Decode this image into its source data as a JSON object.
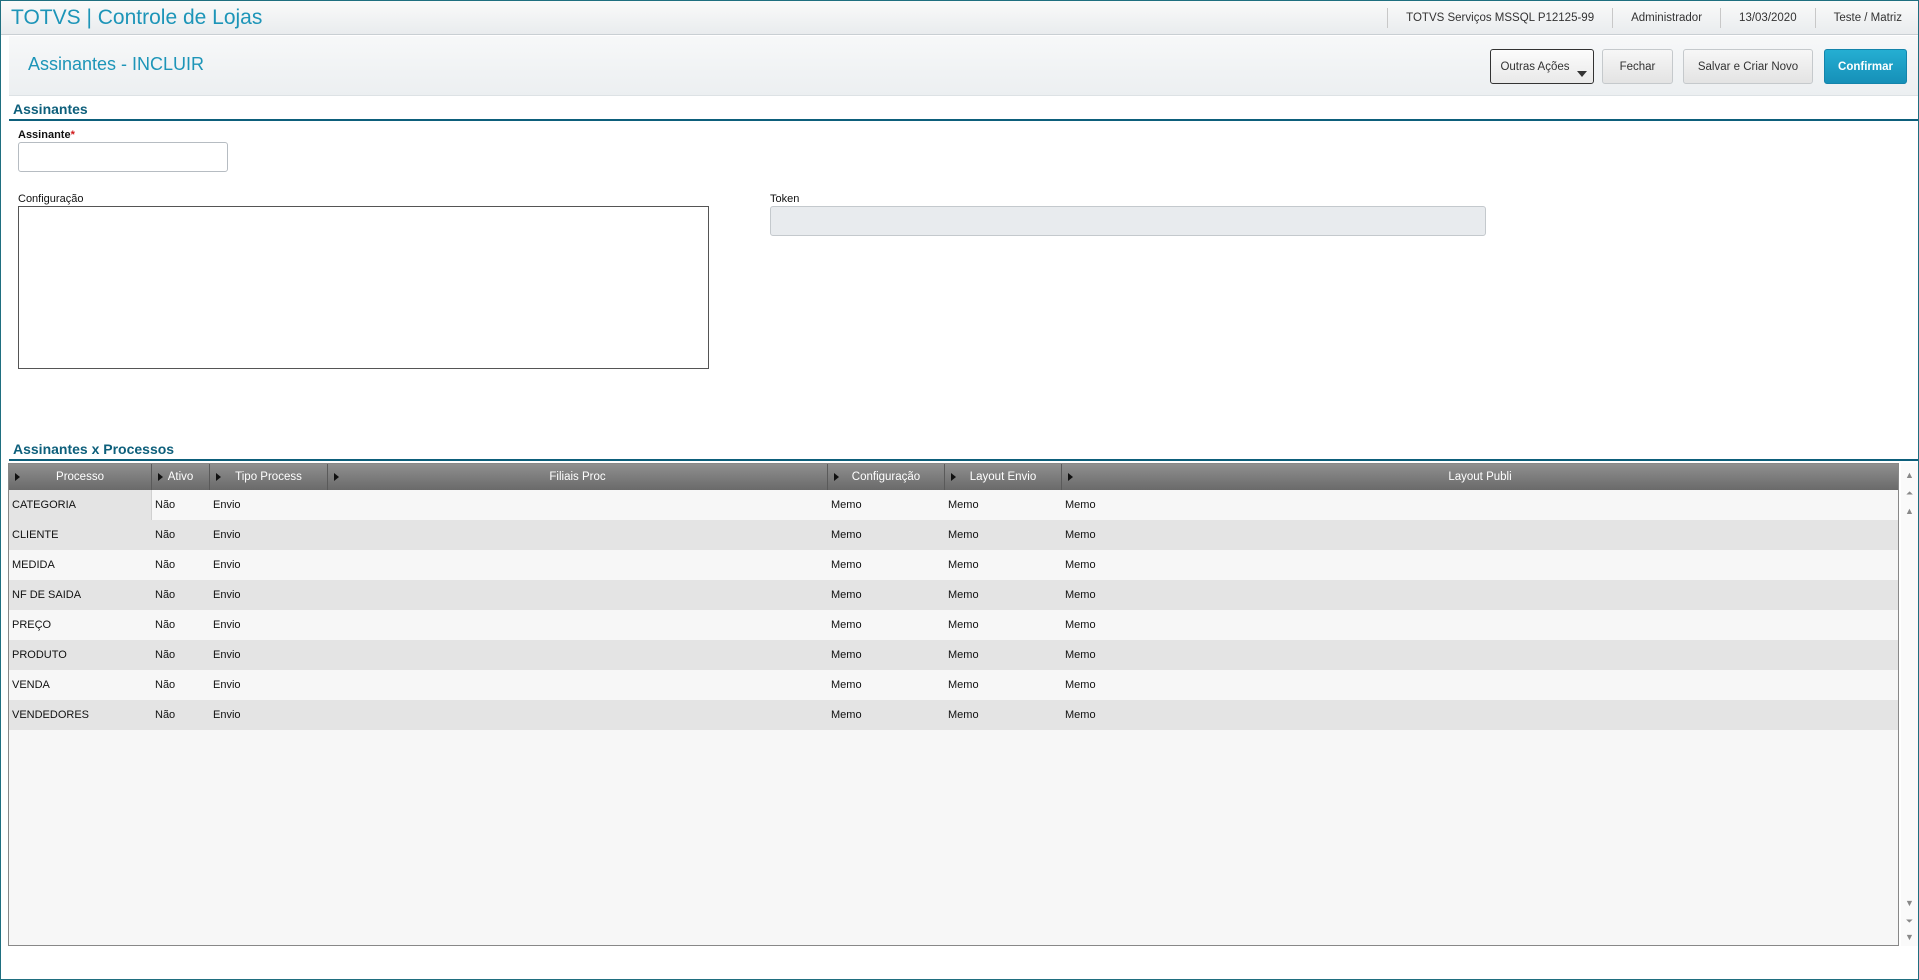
{
  "topbar": {
    "app_title": "TOTVS | Controle de Lojas",
    "environment": "TOTVS Serviços MSSQL P12125-99",
    "user": "Administrador",
    "date": "13/03/2020",
    "branch": "Teste / Matriz"
  },
  "header": {
    "page_title": "Assinantes - INCLUIR",
    "buttons": {
      "outras_acoes": "Outras Ações",
      "fechar": "Fechar",
      "salvar_criar": "Salvar e Criar Novo",
      "confirmar": "Confirmar"
    }
  },
  "form": {
    "section_title": "Assinantes",
    "assinante_label": "Assinante",
    "required_mark": "*",
    "assinante_value": "",
    "configuracao_label": "Configuração",
    "configuracao_value": "",
    "token_label": "Token",
    "token_value": ""
  },
  "grid": {
    "section_title": "Assinantes x Processos",
    "columns": [
      "Processo",
      "Ativo",
      "Tipo Process",
      "Filiais Proc",
      "Configuração",
      "Layout Envio",
      "Layout Publi"
    ],
    "rows": [
      [
        "CATEGORIA",
        "Não",
        "Envio",
        "",
        "Memo",
        "Memo",
        "Memo"
      ],
      [
        "CLIENTE",
        "Não",
        "Envio",
        "",
        "Memo",
        "Memo",
        "Memo"
      ],
      [
        "MEDIDA",
        "Não",
        "Envio",
        "",
        "Memo",
        "Memo",
        "Memo"
      ],
      [
        "NF DE SAIDA",
        "Não",
        "Envio",
        "",
        "Memo",
        "Memo",
        "Memo"
      ],
      [
        "PREÇO",
        "Não",
        "Envio",
        "",
        "Memo",
        "Memo",
        "Memo"
      ],
      [
        "PRODUTO",
        "Não",
        "Envio",
        "",
        "Memo",
        "Memo",
        "Memo"
      ],
      [
        "VENDA",
        "Não",
        "Envio",
        "",
        "Memo",
        "Memo",
        "Memo"
      ],
      [
        "VENDEDORES",
        "Não",
        "Envio",
        "",
        "Memo",
        "Memo",
        "Memo"
      ]
    ]
  },
  "colors": {
    "accent": "#1d95b8",
    "section": "#0d5f7b",
    "primary_button": "#1a9ec6"
  }
}
